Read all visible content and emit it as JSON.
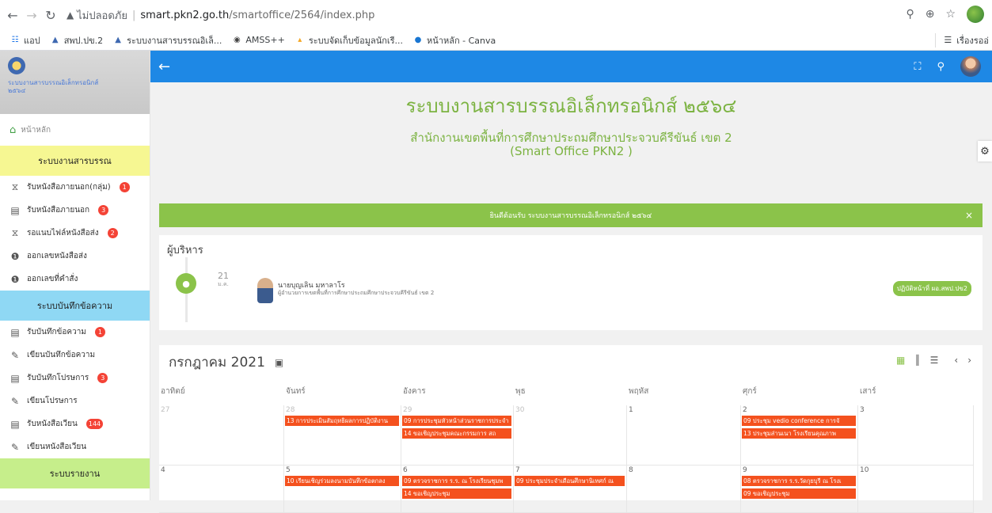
{
  "browser": {
    "insecure_label": "ไม่ปลอดภัย",
    "url_host": "smart.pkn2.go.th",
    "url_path": "/smartoffice/2564/index.php",
    "bookmarks": [
      {
        "label": "แอป",
        "icon": "apps-grid-icon"
      },
      {
        "label": "สพป.ปข.2",
        "icon": "school-icon"
      },
      {
        "label": "ระบบงานสารบรรณอิเล็...",
        "icon": "school-icon"
      },
      {
        "label": "AMSS++",
        "icon": "globe-icon"
      },
      {
        "label": "ระบบจัดเก็บข้อมูลนักเรี...",
        "icon": "flame-icon"
      },
      {
        "label": "หน้าหลัก - Canva",
        "icon": "canva-icon"
      }
    ],
    "bookmarks_right": "เรื่องรออ่"
  },
  "sidebar": {
    "brand_title_line1": "ระบบงานสารบรรณอิเล็กทรอนิกส์",
    "brand_title_line2": "๒๕๖๔",
    "home_label": "หน้าหลัก",
    "section1": "ระบบงานสารบรรณ",
    "section1_items": [
      {
        "label": "รับหนังสือภายนอก(กลุ่ม)",
        "badge": "1",
        "icon": "hourglass-icon"
      },
      {
        "label": "รับหนังสือภายนอก",
        "badge": "3",
        "icon": "document-list-icon"
      },
      {
        "label": "รอแนบไฟล์หนังสือส่ง",
        "badge": "2",
        "icon": "hourglass-icon"
      },
      {
        "label": "ออกเลขหนังสือส่ง",
        "badge": "",
        "icon": "number-one-icon"
      },
      {
        "label": "ออกเลขที่คำสั่ง",
        "badge": "",
        "icon": "number-one-icon"
      }
    ],
    "section2": "ระบบบันทึกข้อความ",
    "section2_items": [
      {
        "label": "รับบันทึกข้อความ",
        "badge": "1",
        "icon": "document-list-icon"
      },
      {
        "label": "เขียนบันทึกข้อความ",
        "badge": "",
        "icon": "pencil-icon"
      },
      {
        "label": "รับบันทึกโปรษการ",
        "badge": "3",
        "icon": "document-list-icon"
      },
      {
        "label": "เขียนโปรษการ",
        "badge": "",
        "icon": "pencil-icon"
      },
      {
        "label": "รับหนังสือเวียน",
        "badge": "144",
        "icon": "document-list-icon"
      },
      {
        "label": "เขียนหนังสือเวียน",
        "badge": "",
        "icon": "pencil-icon"
      }
    ],
    "section3": "ระบบรายงาน"
  },
  "header": {
    "title": "ระบบงานสารบรรณอิเล็กทรอนิกส์ ๒๕๖๔",
    "subtitle1": "สำนักงานเขตพื้นที่การศึกษาประถมศึกษาประจวบคีรีขันธ์ เขต 2",
    "subtitle2": "(Smart Office PKN2 )"
  },
  "alert": {
    "text": "ยินดีต้อนรับ ระบบงานสารบรรณอิเล็กทรอนิกส์ ๒๕๖๔",
    "close": "×"
  },
  "executive": {
    "heading": "ผู้บริหาร",
    "day": "21",
    "month": "ม.ค.",
    "name": "นายบุญเลิน มหาลาโร",
    "position": "ผู้อำนวยการเขตพื้นที่การศึกษาประถมศึกษาประจวบคีรีขันธ์ เขต 2",
    "tag": "ปฏิบัติหน้าที่ ผอ.สพป.ปข2"
  },
  "calendar": {
    "month_title": "กรกฎาคม 2021",
    "days_of_week": [
      "อาทิตย์",
      "จันทร์",
      "อังคาร",
      "พุธ",
      "พฤหัส",
      "ศุกร์",
      "เสาร์"
    ],
    "weeks": [
      {
        "dates": [
          "27",
          "28",
          "29",
          "30",
          "1",
          "2",
          "3"
        ],
        "muted": [
          true,
          true,
          true,
          true,
          false,
          false,
          false
        ],
        "events": [
          [],
          [
            "13 การประเมินสัมฤทธิผลการปฏิบัติงาน"
          ],
          [
            "09 การประชุมหัวหน้าส่วนราชการประจำ",
            "14 ขอเชิญประชุมคณะกรรมการ สถ"
          ],
          [],
          [],
          [
            "09 ประชุม vedio conference การจั",
            "13 ประชุมส่านเนา โรงเรียนคุณภาพ"
          ],
          []
        ]
      },
      {
        "dates": [
          "4",
          "5",
          "6",
          "7",
          "8",
          "9",
          "10"
        ],
        "muted": [
          false,
          false,
          false,
          false,
          false,
          false,
          false
        ],
        "events": [
          [],
          [
            "10 เรียนเชิญร่วมลงนามบันทึกข้อตกลง"
          ],
          [
            "09 ตรวจราชการ ร.ร. ณ โรงเรียนชุมพ",
            "14 ขอเชิญประชุม"
          ],
          [
            "09 ประชุมประจำเดือนศึกษานิเทศก์ ณ"
          ],
          [],
          [
            "08 ตรวจราชการ ร.ร.วัดกุยบุรี ณ โรงเ",
            "09 ขอเชิญประชุม"
          ],
          []
        ]
      }
    ]
  },
  "colors": {
    "accent": "#8bc34a",
    "topbar": "#1e88e5",
    "event": "#f4511e"
  }
}
